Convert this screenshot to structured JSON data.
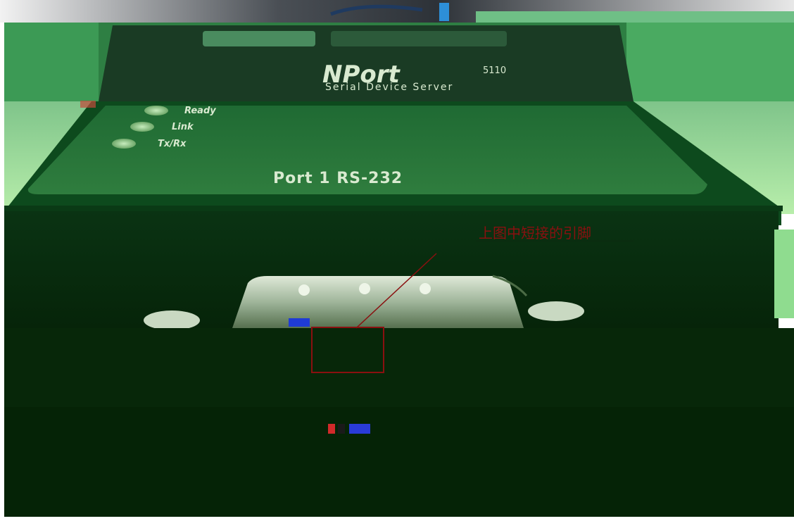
{
  "photo": {
    "device": {
      "brand": "NPort",
      "model": "5110",
      "subtitle": "Serial Device Server",
      "leds": [
        {
          "label": "Ready"
        },
        {
          "label": "Link"
        },
        {
          "label": "Tx/Rx"
        }
      ],
      "port_label": "Port 1  RS-232"
    },
    "annotation": {
      "text": "上图中短接的引脚",
      "color": "#8a1010"
    },
    "colors": {
      "green_tint": "#0f5a23",
      "dark_green": "#062a0d",
      "light_green": "#b5f0a6"
    }
  }
}
